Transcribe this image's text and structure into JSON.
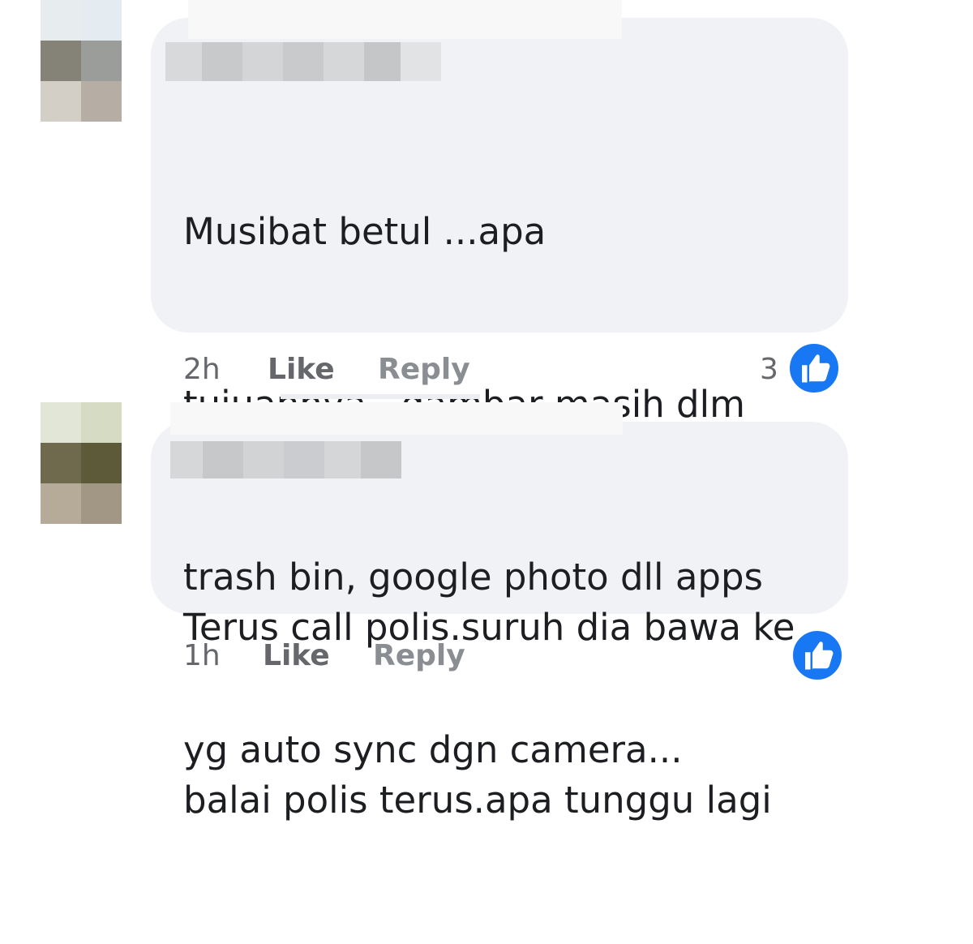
{
  "comments": [
    {
      "text_lines": [
        "Musibat betul ...apa",
        "tujuannya...gambar masih dlm",
        "trash bin, google photo dll apps",
        "yg auto sync dgn camera..."
      ],
      "time": "2h",
      "like_label": "Like",
      "reply_label": "Reply",
      "reaction_count": "3",
      "reaction_icon": "thumbs-up-icon"
    },
    {
      "text_lines": [
        "Terus call polis.suruh dia bawa ke",
        "balai polis terus.apa tunggu lagi"
      ],
      "time": "1h",
      "like_label": "Like",
      "reply_label": "Reply",
      "reaction_count": "",
      "reaction_icon": "thumbs-up-icon"
    }
  ],
  "colors": {
    "bubble": "#f0f2f5",
    "text": "#1c1e21",
    "meta": "#65676b",
    "like_badge": "#1877f2"
  }
}
